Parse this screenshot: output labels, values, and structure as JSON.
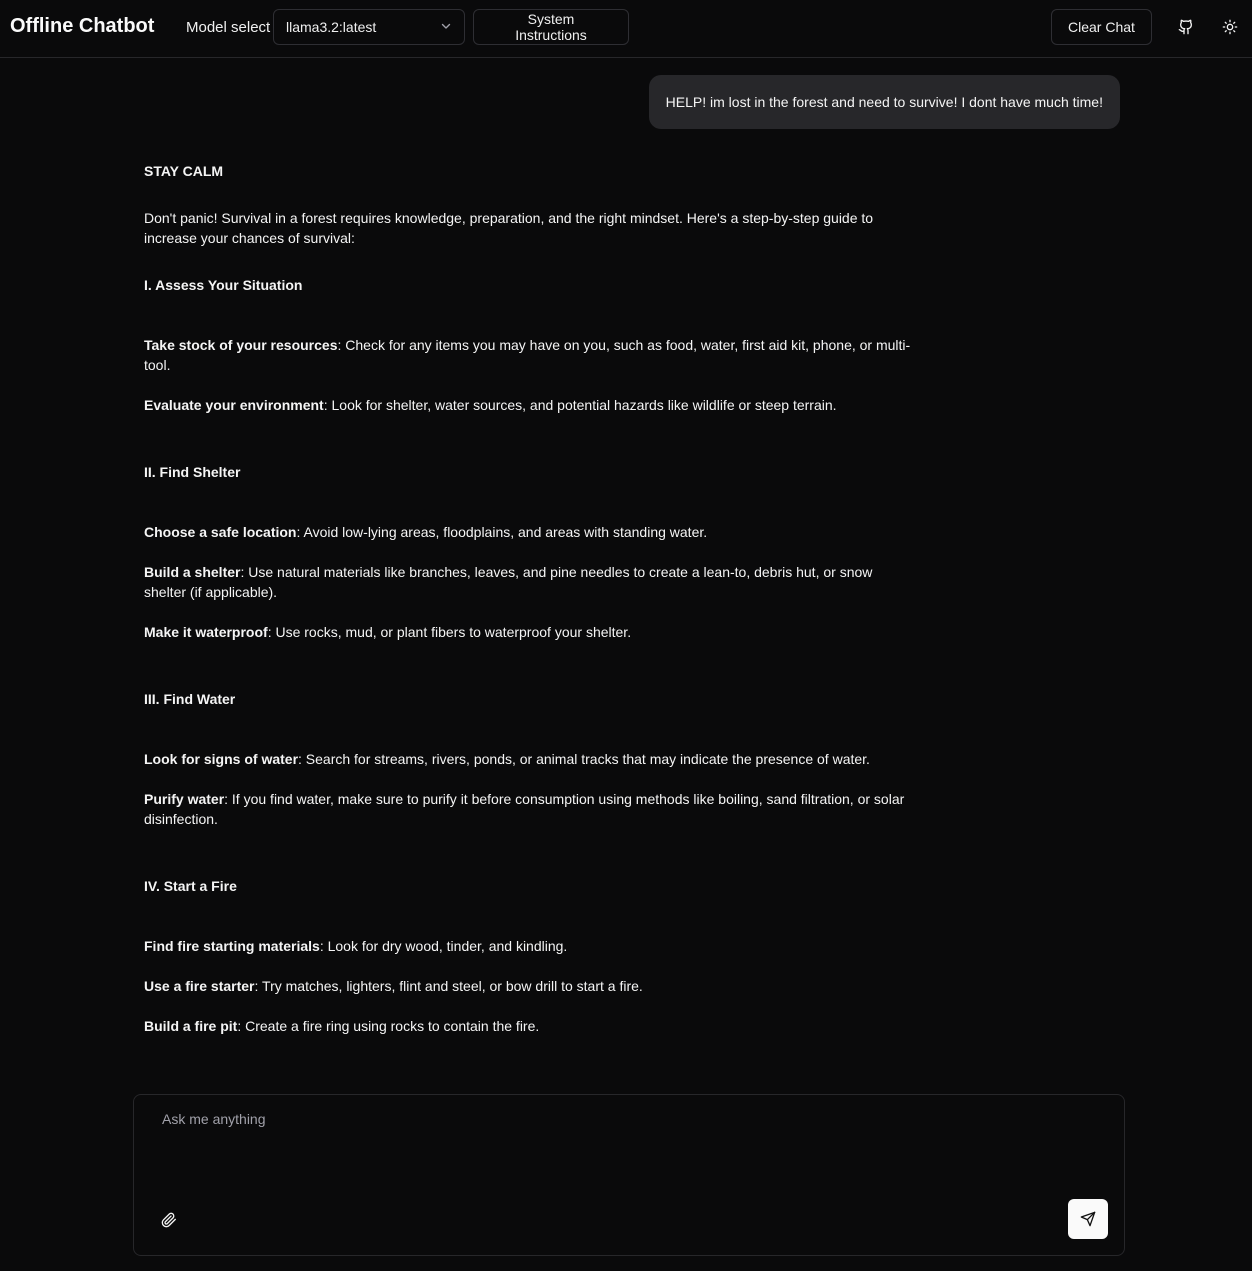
{
  "header": {
    "app_title": "Offline Chatbot",
    "model_label": "Model select",
    "model_value": "llama3.2:latest",
    "system_instructions_label": "System Instructions",
    "clear_chat_label": "Clear Chat",
    "github_icon": "github-icon",
    "theme_icon": "sun-icon"
  },
  "conversation": {
    "user_message": "HELP! im lost in the forest and need to survive! I dont have much time!",
    "assistant": {
      "title": "STAY CALM",
      "intro": "Don't panic! Survival in a forest requires knowledge, preparation, and the right mindset. Here's a step-by-step guide to increase your chances of survival:",
      "sections": [
        {
          "heading": "I. Assess Your Situation",
          "items": [
            {
              "term": "Take stock of your resources",
              "text": ": Check for any items you may have on you, such as food, water, first aid kit, phone, or multi-tool."
            },
            {
              "term": "Evaluate your environment",
              "text": ": Look for shelter, water sources, and potential hazards like wildlife or steep terrain."
            }
          ]
        },
        {
          "heading": "II. Find Shelter",
          "items": [
            {
              "term": "Choose a safe location",
              "text": ": Avoid low-lying areas, floodplains, and areas with standing water."
            },
            {
              "term": "Build a shelter",
              "text": ": Use natural materials like branches, leaves, and pine needles to create a lean-to, debris hut, or snow shelter (if applicable)."
            },
            {
              "term": "Make it waterproof",
              "text": ": Use rocks, mud, or plant fibers to waterproof your shelter."
            }
          ]
        },
        {
          "heading": "III. Find Water",
          "items": [
            {
              "term": "Look for signs of water",
              "text": ": Search for streams, rivers, ponds, or animal tracks that may indicate the presence of water."
            },
            {
              "term": "Purify water",
              "text": ": If you find water, make sure to purify it before consumption using methods like boiling, sand filtration, or solar disinfection."
            }
          ]
        },
        {
          "heading": "IV. Start a Fire",
          "items": [
            {
              "term": "Find fire starting materials",
              "text": ": Look for dry wood, tinder, and kindling."
            },
            {
              "term": "Use a fire starter",
              "text": ": Try matches, lighters, flint and steel, or bow drill to start a fire."
            },
            {
              "term": "Build a fire pit",
              "text": ": Create a fire ring using rocks to contain the fire."
            }
          ]
        }
      ]
    }
  },
  "composer": {
    "placeholder": "Ask me anything",
    "attach_icon": "paperclip-icon",
    "send_icon": "send-icon"
  }
}
